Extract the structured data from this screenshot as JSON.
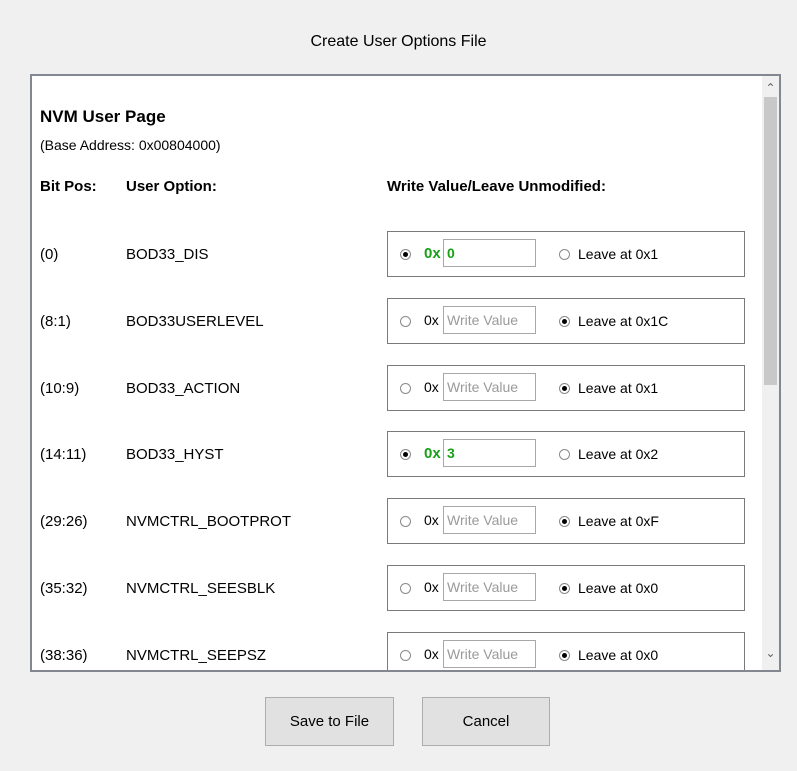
{
  "dialog": {
    "title": "Create User Options File"
  },
  "section": {
    "title": "NVM User Page",
    "base_address": "(Base Address: 0x00804000)",
    "headers": {
      "bit_pos": "Bit Pos:",
      "user_option": "User Option:",
      "write_value": "Write Value/Leave Unmodified:"
    }
  },
  "write_placeholder": "Write Value",
  "rows": [
    {
      "bit_pos": "(0)",
      "name": "BOD33_DIS",
      "mode": "write",
      "prefix": "0x",
      "value": "0",
      "leave_label": "Leave at 0x1"
    },
    {
      "bit_pos": "(8:1)",
      "name": "BOD33USERLEVEL",
      "mode": "leave",
      "prefix": "0x",
      "value": "",
      "leave_label": "Leave at 0x1C"
    },
    {
      "bit_pos": "(10:9)",
      "name": "BOD33_ACTION",
      "mode": "leave",
      "prefix": "0x",
      "value": "",
      "leave_label": "Leave at 0x1"
    },
    {
      "bit_pos": "(14:11)",
      "name": "BOD33_HYST",
      "mode": "write",
      "prefix": "0x",
      "value": "3",
      "leave_label": "Leave at 0x2"
    },
    {
      "bit_pos": "(29:26)",
      "name": "NVMCTRL_BOOTPROT",
      "mode": "leave",
      "prefix": "0x",
      "value": "",
      "leave_label": "Leave at 0xF"
    },
    {
      "bit_pos": "(35:32)",
      "name": "NVMCTRL_SEESBLK",
      "mode": "leave",
      "prefix": "0x",
      "value": "",
      "leave_label": "Leave at 0x0"
    },
    {
      "bit_pos": "(38:36)",
      "name": "NVMCTRL_SEEPSZ",
      "mode": "leave",
      "prefix": "0x",
      "value": "",
      "leave_label": "Leave at 0x0"
    }
  ],
  "buttons": {
    "save": "Save to File",
    "cancel": "Cancel"
  },
  "colors": {
    "active_value": "#18a018",
    "border": "#7a7a7a"
  },
  "scrollbar": {
    "up_icon": "chevron-up-icon",
    "down_icon": "chevron-down-icon"
  }
}
